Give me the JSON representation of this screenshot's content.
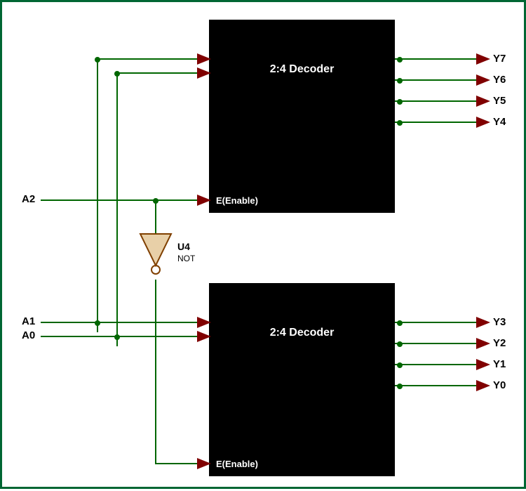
{
  "decoder_top": {
    "title": "2:4 Decoder",
    "enable": "E(Enable)"
  },
  "decoder_bot": {
    "title": "2:4 Decoder",
    "enable": "E(Enable)"
  },
  "inputs": {
    "A2": "A2",
    "A1": "A1",
    "A0": "A0"
  },
  "outputs": {
    "Y7": "Y7",
    "Y6": "Y6",
    "Y5": "Y5",
    "Y4": "Y4",
    "Y3": "Y3",
    "Y2": "Y2",
    "Y1": "Y1",
    "Y0": "Y0"
  },
  "not_gate": {
    "ref": "U4",
    "type": "NOT"
  }
}
